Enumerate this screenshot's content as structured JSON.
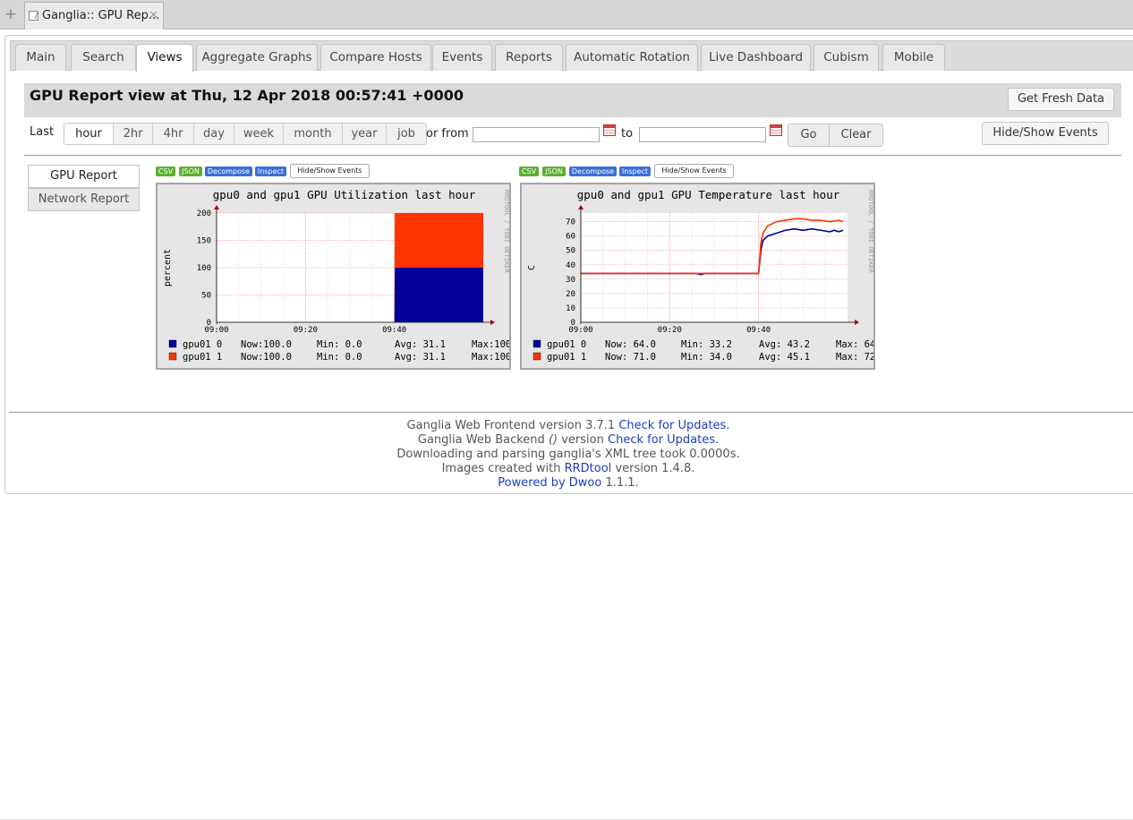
{
  "browser": {
    "tab_title": "Ganglia:: GPU Rep...",
    "new_tab": "+",
    "close": "✕"
  },
  "nav": {
    "tabs": [
      "Main",
      "Search",
      "Views",
      "Aggregate Graphs",
      "Compare Hosts",
      "Events",
      "Reports",
      "Automatic Rotation",
      "Live Dashboard",
      "Cubism",
      "Mobile"
    ],
    "active": "Views"
  },
  "header": {
    "title": "GPU Report view at Thu, 12 Apr 2018 00:57:41 +0000",
    "fresh_button": "Get Fresh Data"
  },
  "range": {
    "label": "Last",
    "options": [
      "hour",
      "2hr",
      "4hr",
      "day",
      "week",
      "month",
      "year",
      "job"
    ],
    "active": "hour",
    "or_from": "or from",
    "to": "to",
    "from_value": "",
    "to_value": "",
    "go": "Go",
    "clear": "Clear",
    "hide_show_events": "Hide/Show Events"
  },
  "sidebar": {
    "items": [
      "GPU Report",
      "Network Report"
    ]
  },
  "graph_tools": {
    "csv": "CSV",
    "json": "JSON",
    "decompose": "Decompose",
    "inspect": "Inspect",
    "hide_show": "Hide/Show Events"
  },
  "colors": {
    "gpu0": "#000099",
    "gpu1": "#ff3300",
    "grid": "#ff9999",
    "plot_bg": "#ffffff",
    "graph_bg": "#e6e6e6",
    "link": "#1a3ec0"
  },
  "chart_data": [
    {
      "type": "area",
      "title": "gpu0 and gpu1 GPU Utilization last hour",
      "ylabel": "percent",
      "watermark": "RRDTOOL / TOBI OETIKER",
      "stacked": true,
      "x_ticks": [
        "09:00",
        "09:20",
        "09:40"
      ],
      "x_range_min": [
        0,
        60
      ],
      "y_ticks": [
        0,
        50,
        100,
        150,
        200
      ],
      "ylim": [
        0,
        200
      ],
      "grid": true,
      "series": [
        {
          "name": "gpu01 0",
          "color": "#000099",
          "points": [
            [
              0,
              0
            ],
            [
              40,
              0
            ],
            [
              40.1,
              100
            ],
            [
              60,
              100
            ]
          ]
        },
        {
          "name": "gpu01 1",
          "color": "#ff3300",
          "points": [
            [
              0,
              0
            ],
            [
              40,
              0
            ],
            [
              40.1,
              100
            ],
            [
              60,
              100
            ]
          ]
        }
      ],
      "legend": [
        {
          "name": "gpu01 0",
          "color": "#000099",
          "now": "Now:100.0",
          "min": "Min:   0.0",
          "avg": "Avg: 31.1",
          "max": "Max:100"
        },
        {
          "name": "gpu01 1",
          "color": "#ff3300",
          "now": "Now:100.0",
          "min": "Min:   0.0",
          "avg": "Avg: 31.1",
          "max": "Max:100"
        }
      ]
    },
    {
      "type": "line",
      "title": "gpu0 and gpu1 GPU Temperature last hour",
      "ylabel": "C",
      "watermark": "RRDTOOL / TOBI OETIKER",
      "x_ticks": [
        "09:00",
        "09:20",
        "09:40"
      ],
      "x_range_min": [
        0,
        60
      ],
      "y_ticks": [
        0,
        10,
        20,
        30,
        40,
        50,
        60,
        70
      ],
      "ylim": [
        0,
        76
      ],
      "grid": true,
      "series": [
        {
          "name": "gpu01 0",
          "color": "#000099",
          "points": [
            [
              0,
              34
            ],
            [
              26,
              34
            ],
            [
              27,
              33.2
            ],
            [
              28,
              34
            ],
            [
              40,
              34
            ],
            [
              40.5,
              50
            ],
            [
              41,
              57
            ],
            [
              42,
              60
            ],
            [
              44,
              62
            ],
            [
              46,
              64
            ],
            [
              48,
              65
            ],
            [
              50,
              64
            ],
            [
              52,
              65
            ],
            [
              54,
              64
            ],
            [
              56,
              63
            ],
            [
              57,
              64
            ],
            [
              58,
              63
            ],
            [
              59,
              64
            ]
          ]
        },
        {
          "name": "gpu01 1",
          "color": "#ff3300",
          "points": [
            [
              0,
              34
            ],
            [
              40,
              34
            ],
            [
              40.5,
              55
            ],
            [
              41,
              62
            ],
            [
              42,
              67
            ],
            [
              44,
              70
            ],
            [
              46,
              71
            ],
            [
              48,
              72
            ],
            [
              50,
              72
            ],
            [
              52,
              71
            ],
            [
              54,
              71
            ],
            [
              56,
              70
            ],
            [
              58,
              71
            ],
            [
              59,
              70
            ]
          ]
        }
      ],
      "legend": [
        {
          "name": "gpu01 0",
          "color": "#000099",
          "now": "Now: 64.0",
          "min": "Min: 33.2",
          "avg": "Avg: 43.2",
          "max": "Max: 64"
        },
        {
          "name": "gpu01 1",
          "color": "#ff3300",
          "now": "Now: 71.0",
          "min": "Min: 34.0",
          "avg": "Avg: 45.1",
          "max": "Max: 72"
        }
      ]
    }
  ],
  "footer": {
    "line1_text": "Ganglia Web Frontend version 3.7.1",
    "line1_link": "Check for Updates.",
    "line2_text_a": "Ganglia Web Backend",
    "line2_text_b": "()",
    "line2_text_c": "version",
    "line2_link": "Check for Updates.",
    "line3": "Downloading and parsing ganglia's XML tree took 0.0000s.",
    "line4_text_a": "Images created with",
    "line4_link": "RRDtool",
    "line4_text_b": "version 1.4.8.",
    "line5_link": "Powered by Dwoo",
    "line5_text": "1.1.1."
  }
}
